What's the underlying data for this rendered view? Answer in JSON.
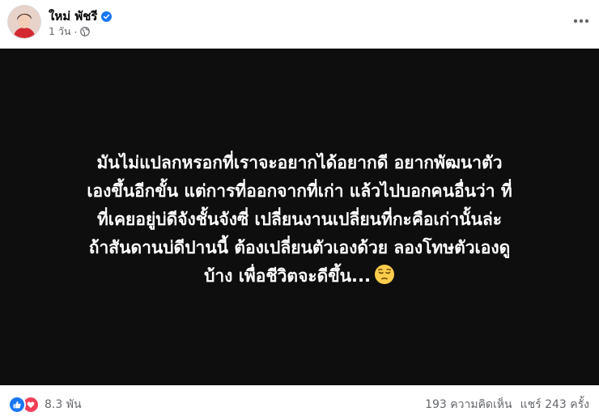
{
  "post": {
    "author": "ใหม่ พัชรี",
    "time": "1 วัน",
    "dot": "·",
    "text": "มันไม่แปลกหรอกที่เราจะอยากได้อยากดี อยากพัฒนาตัว\nเองขึ้นอีกขั้น แต่การที่ออกจากที่เก่า แล้วไปบอกคนอื่นว่า ที่\nที่เคยอยู่บ่ดีจังชั้นจังซี่ เปลี่ยนงานเปลี่ยนที่กะคือเก่านั้นล่ะ\nถ้าสันดานบ่ดีปานนี้ ต้องเปลี่ยนตัวเองด้วย ลองโทษตัวเองดู\nบ้าง เพื่อชีวิตจะดีขึ้น...",
    "emoji": "pensive-face-emoji",
    "background_color": "#0e0e0e"
  },
  "reactions": {
    "count": "8.3 พัน",
    "types": [
      "like-icon",
      "love-icon"
    ]
  },
  "stats": {
    "comments": "193 ความคิดเห็น",
    "shares": "แชร์ 243 ครั้ง"
  },
  "colors": {
    "like": "#1877f2",
    "love": "#f33e58",
    "verified": "#1877f2",
    "meta_text": "#65676b"
  }
}
